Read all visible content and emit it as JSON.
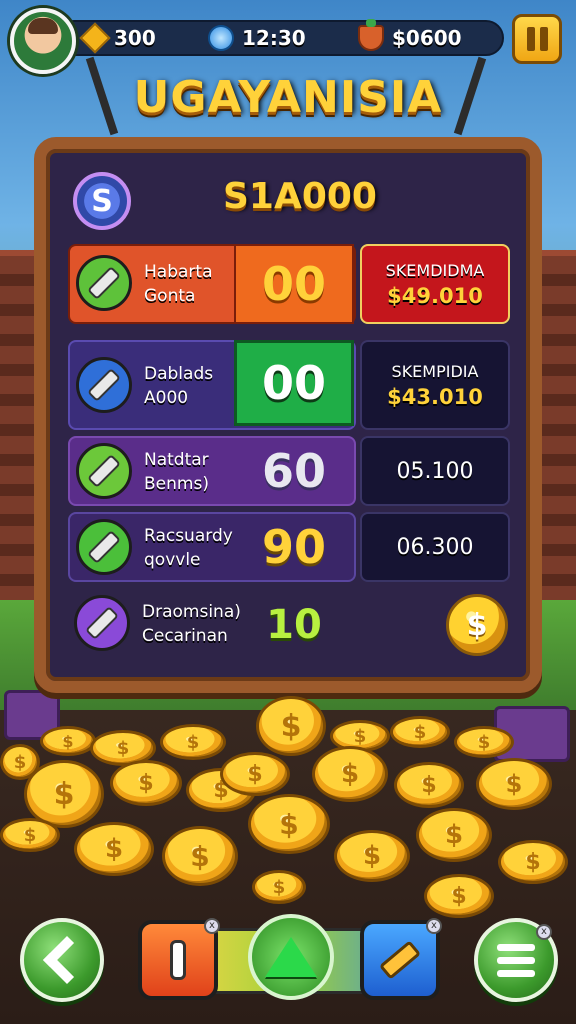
{
  "top_bar": {
    "gold": "300",
    "time": "12:30",
    "cash": "$0600"
  },
  "title": "UGAYANISIA",
  "board": {
    "total": "S1A000",
    "badge_symbol": "S",
    "rows": [
      {
        "label_line1": "Habarta",
        "label_line2": "Gonta",
        "score": "00",
        "icon_color": "#5ec23a",
        "panel_title": "SKEMDIDMA",
        "panel_value": "$49.010"
      },
      {
        "label_line1": "Dablads",
        "label_line2": "A000",
        "score": "00",
        "icon_color": "#2f6fd8",
        "panel_title": "SKEMPIDIA",
        "panel_value": "$43.010"
      },
      {
        "label_line1": "Natdtar",
        "label_line2": "Benms)",
        "score": "60",
        "icon_color": "#6cc83a",
        "panel_value": "05.100"
      },
      {
        "label_line1": "Racsuardy",
        "label_line2": "qovvle",
        "score": "90",
        "icon_color": "#4bbf3a",
        "panel_value": "06.300"
      },
      {
        "label_line1": "Draomsina)",
        "label_line2": "Cecarinan",
        "score": "10",
        "icon_color": "#8a4ad8"
      }
    ],
    "coin_symbol": "$"
  },
  "coin_symbol": "$",
  "colors": {
    "row1_bg": "#e0542a",
    "row1_score_bg": "#ef6a1e",
    "row1_panel_bg": "#c4161c",
    "row2_score_bg": "#1fae47",
    "accent_gold": "#ffd23a"
  },
  "controls": {
    "back": "back-icon",
    "menu": "menu-icon",
    "tools": [
      "key-icon",
      "star-arrow-icon",
      "hammer-icon"
    ]
  }
}
